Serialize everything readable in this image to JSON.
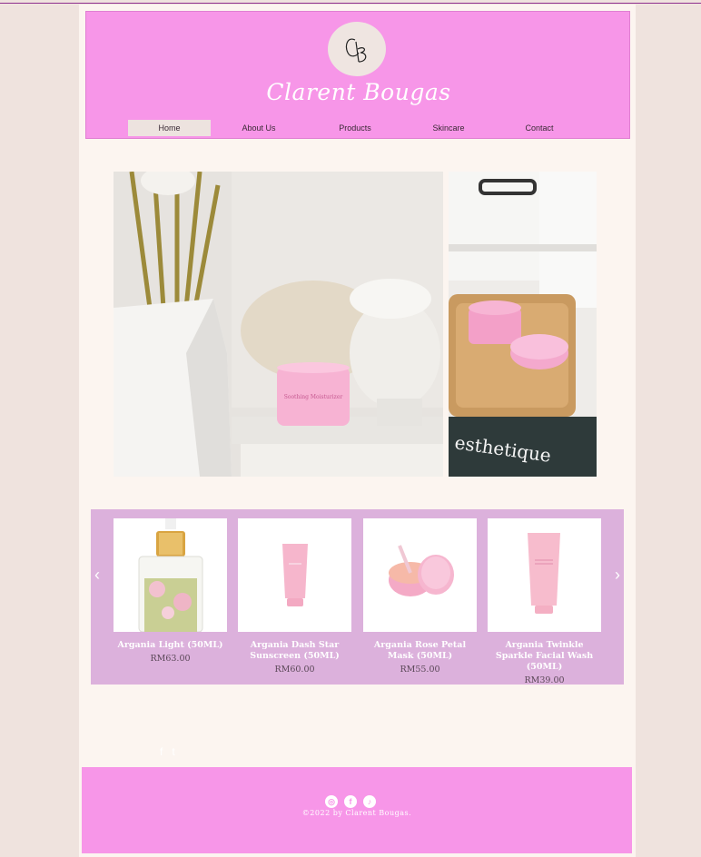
{
  "brand": {
    "name": "Clarent Bougas",
    "monogram": "CB"
  },
  "nav": {
    "items": [
      {
        "label": "Home",
        "active": true
      },
      {
        "label": "About Us",
        "active": false
      },
      {
        "label": "Products",
        "active": false
      },
      {
        "label": "Skincare",
        "active": false
      },
      {
        "label": "Contact",
        "active": false
      }
    ]
  },
  "hero": {
    "left_image": "skincare-jar-with-statue-photo",
    "right_image": "skincare-jars-on-tray-photo",
    "book_text": "esthetique"
  },
  "products": {
    "prev_icon": "chevron-left-icon",
    "next_icon": "chevron-right-icon",
    "items": [
      {
        "name": "Argania Light (50ML)",
        "price": "RM63.00",
        "image": "serum-bottle"
      },
      {
        "name": "Argania Dash Star Sunscreen (50ML)",
        "price": "RM60.00",
        "image": "pink-tube"
      },
      {
        "name": "Argania Rose Petal Mask (50ML)",
        "price": "RM55.00",
        "image": "pink-jar"
      },
      {
        "name": "Argania Twinkle Sparkle Facial Wash (50ML)",
        "price": "RM39.00",
        "image": "pink-tube-wash"
      }
    ]
  },
  "social_small": {
    "facebook": "f",
    "twitter": "t"
  },
  "footer": {
    "icons": [
      "instagram-icon",
      "facebook-icon",
      "tiktok-icon"
    ],
    "copyright": "©2022 by Clarent Bougas."
  },
  "colors": {
    "pink": "#f796e8",
    "lilac": "#dcb1dc",
    "cream": "#fcf5f0",
    "bg": "#efe3de"
  }
}
